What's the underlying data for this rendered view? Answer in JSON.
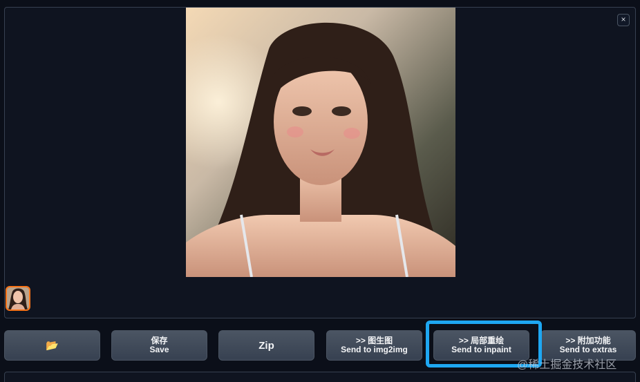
{
  "gallery": {
    "close_icon": "×",
    "main_image_alt": "",
    "thumbnail_selected": true
  },
  "buttons": {
    "open_folder_icon": "📂",
    "save": {
      "line1": "保存",
      "line2": "Save"
    },
    "zip": "Zip",
    "img2img": {
      "line1": ">> 图生图",
      "line2": "Send to img2img"
    },
    "inpaint": {
      "line1": ">> 局部重绘",
      "line2": "Send to inpaint"
    },
    "extras": {
      "line1": ">> 附加功能",
      "line2": "Send to extras"
    }
  },
  "watermark": "@稀土掘金技术社区",
  "colors": {
    "background": "#0b0f19",
    "button": "#374151",
    "highlight": "#1ea7f2",
    "thumb_border": "#f97316"
  }
}
